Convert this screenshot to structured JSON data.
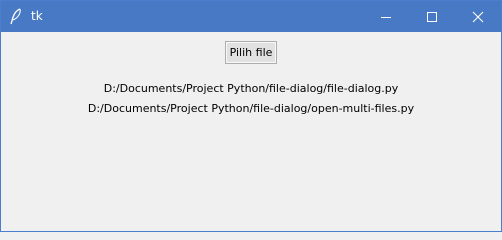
{
  "window": {
    "title": "tk",
    "controls": {
      "minimize_icon": "minimize-icon",
      "maximize_icon": "maximize-icon",
      "close_icon": "close-icon"
    },
    "titlebar_color": "#4779c4"
  },
  "main": {
    "pick_file_label": "Pilih file",
    "selected_files": [
      "D:/Documents/Project Python/file-dialog/file-dialog.py",
      "D:/Documents/Project Python/file-dialog/open-multi-files.py"
    ]
  }
}
